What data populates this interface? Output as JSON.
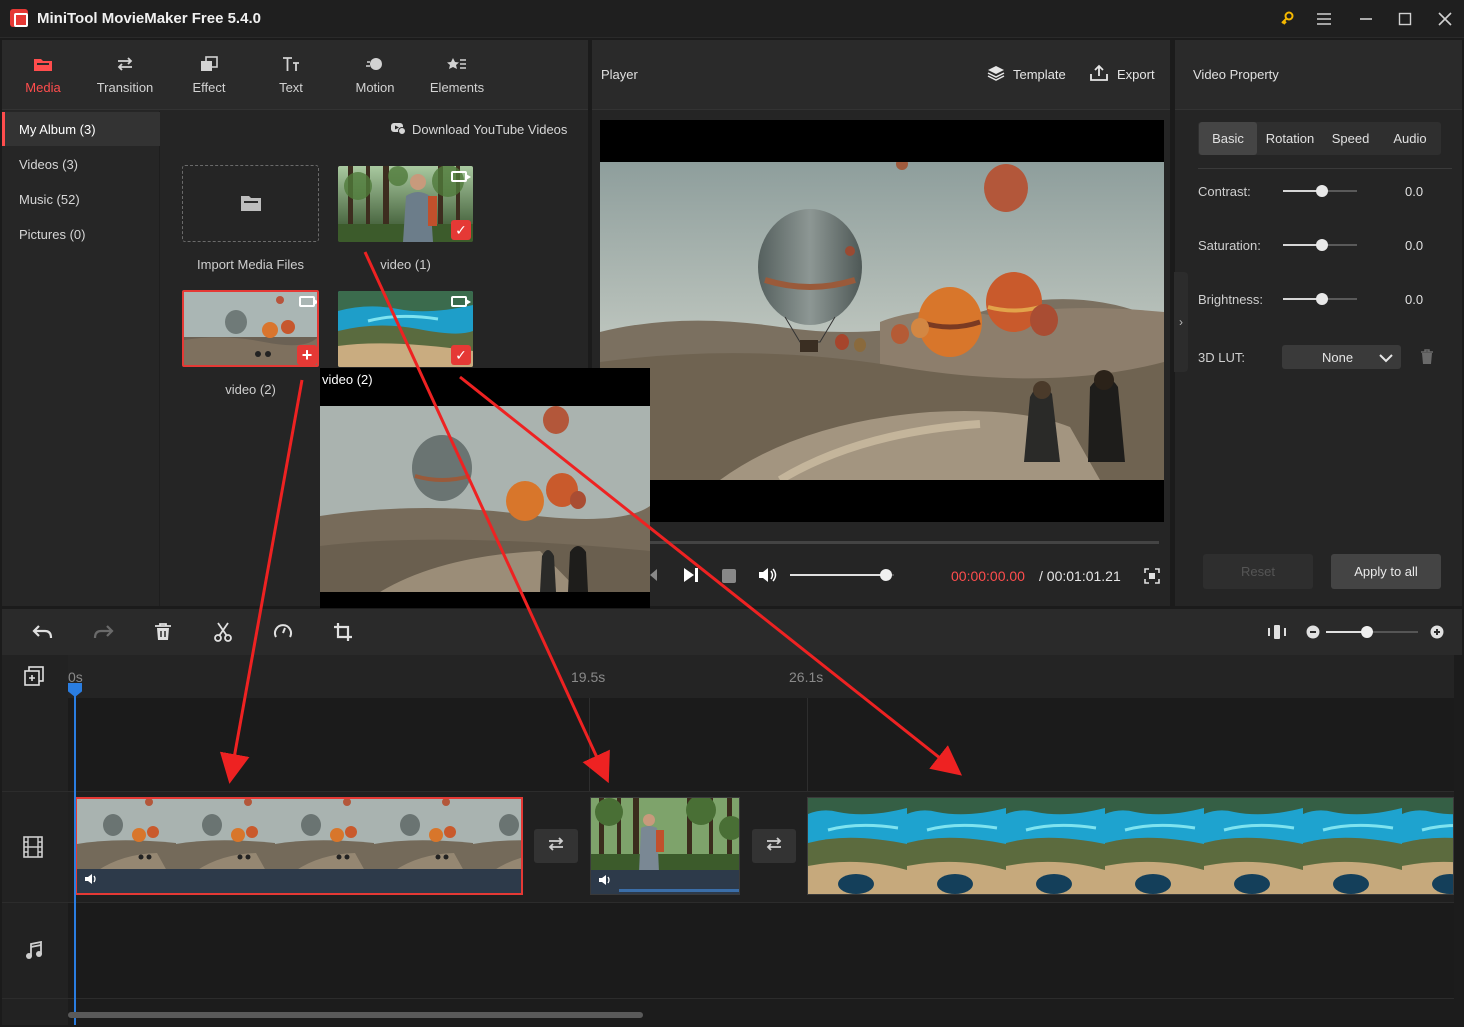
{
  "app": {
    "title": "MiniTool MovieMaker Free 5.4.0"
  },
  "media_tabs": [
    {
      "label": "Media",
      "icon": "folder-icon",
      "active": true
    },
    {
      "label": "Transition",
      "icon": "transition-arrows-icon"
    },
    {
      "label": "Effect",
      "icon": "effect-icon"
    },
    {
      "label": "Text",
      "icon": "text-icon"
    },
    {
      "label": "Motion",
      "icon": "motion-icon"
    },
    {
      "label": "Elements",
      "icon": "elements-icon"
    }
  ],
  "albums": [
    {
      "label": "My Album (3)",
      "active": true
    },
    {
      "label": "Videos (3)"
    },
    {
      "label": "Music (52)"
    },
    {
      "label": "Pictures (0)"
    }
  ],
  "download_youtube": "Download YouTube Videos",
  "media_items": {
    "import": "Import Media Files",
    "video1": "video (1)",
    "video2": "video (2)",
    "hover_preview_title": "video (2)"
  },
  "player": {
    "label": "Player",
    "template": "Template",
    "export": "Export",
    "time_current": "00:00:00.00",
    "time_total": "/ 00:01:01.21",
    "volume_level": 0.92,
    "progress": 0.0
  },
  "property": {
    "title": "Video Property",
    "tabs": [
      "Basic",
      "Rotation",
      "Speed",
      "Audio"
    ],
    "active_tab": "Basic",
    "contrast_label": "Contrast:",
    "contrast_value": "0.0",
    "saturation_label": "Saturation:",
    "saturation_value": "0.0",
    "brightness_label": "Brightness:",
    "brightness_value": "0.0",
    "lut_label": "3D LUT:",
    "lut_value": "None",
    "reset": "Reset",
    "apply": "Apply to all"
  },
  "timeline": {
    "ticks": [
      "0s",
      "19.5s",
      "26.1s"
    ],
    "zoom_level": 0.45
  },
  "colors": {
    "accent": "#ff4d4d",
    "playhead": "#2a7de1",
    "annotation_arrow": "#ee2222"
  }
}
